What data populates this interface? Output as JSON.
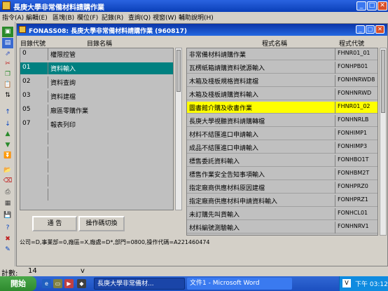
{
  "app": {
    "title": "長庚大學非常備材料請購作業"
  },
  "menu": [
    "指令(A)",
    "編輯(E)",
    "區塊(B)",
    "欄位(F)",
    "記錄(R)",
    "查詢(Q)",
    "視窗(W)",
    "輔助說明(H)"
  ],
  "form": {
    "title": "FONASS08: 長庚大學非常備材料請購作業 (960817)",
    "left_headers": {
      "code": "目錄代號",
      "name": "目錄名稱"
    },
    "right_headers": {
      "name": "程式名稱",
      "code": "程式代號"
    },
    "catalog": [
      {
        "code": "0",
        "name": "權限控管",
        "selected": false
      },
      {
        "code": "01",
        "name": "資料輸入",
        "selected": true
      },
      {
        "code": "02",
        "name": "資料查詢",
        "selected": false
      },
      {
        "code": "03",
        "name": "資料建檔",
        "selected": false
      },
      {
        "code": "05",
        "name": "廠區零購作業",
        "selected": false
      },
      {
        "code": "07",
        "name": "報表列印",
        "selected": false
      }
    ],
    "programs": [
      {
        "name": "非常備材料請購作業",
        "code": "FHNR01_01",
        "selected": false
      },
      {
        "name": "瓦楞紙箱請購資料號源輸入",
        "code": "FONHPB01",
        "selected": false
      },
      {
        "name": "木箱及棧板規格資料建檔",
        "code": "FONHNRWD8",
        "selected": false
      },
      {
        "name": "木箱及棧板請購資料輸入",
        "code": "FONHNRWD",
        "selected": false
      },
      {
        "name": "圖書館介購及收書作業",
        "code": "FHNR01_02",
        "selected": true
      },
      {
        "name": "長庚大學視聽資料請購轉檔",
        "code": "FONHNRLB",
        "selected": false
      },
      {
        "name": "材料不結匯進口申請輸入",
        "code": "FONHIMP1",
        "selected": false
      },
      {
        "name": "成品不結匯進口申請輸入",
        "code": "FONHIMP3",
        "selected": false
      },
      {
        "name": "標售委託資料輸入",
        "code": "FONHBO1T",
        "selected": false
      },
      {
        "name": "標售作業安全告知事項輸入",
        "code": "FONHBM2T",
        "selected": false
      },
      {
        "name": "指定廠商供應材料原因建檔",
        "code": "FONHPRZ0",
        "selected": false
      },
      {
        "name": "指定廠商供應材料申請資料輸入",
        "code": "FONHPRZ1",
        "selected": false
      },
      {
        "name": "未訂購先叫貨輸入",
        "code": "FONHCL01",
        "selected": false
      },
      {
        "name": "材料編號測驗輸入",
        "code": "FONHNRV1",
        "selected": false
      }
    ],
    "buttons": {
      "notice": "通 告",
      "switch": "操作碼切換"
    },
    "info": "公司=D,事業部=0,廠區=X,廠處=D*,部門=0800,操作代碼=A221460474"
  },
  "status": {
    "count_label": "計數:",
    "count_value": "14",
    "indicator": "v"
  },
  "taskbar": {
    "start": "開始",
    "tasks": [
      "長庚大學非常備材...",
      "文件1 - Microsoft Word"
    ],
    "tray_lang": "V",
    "clock": "下午 03:12"
  }
}
